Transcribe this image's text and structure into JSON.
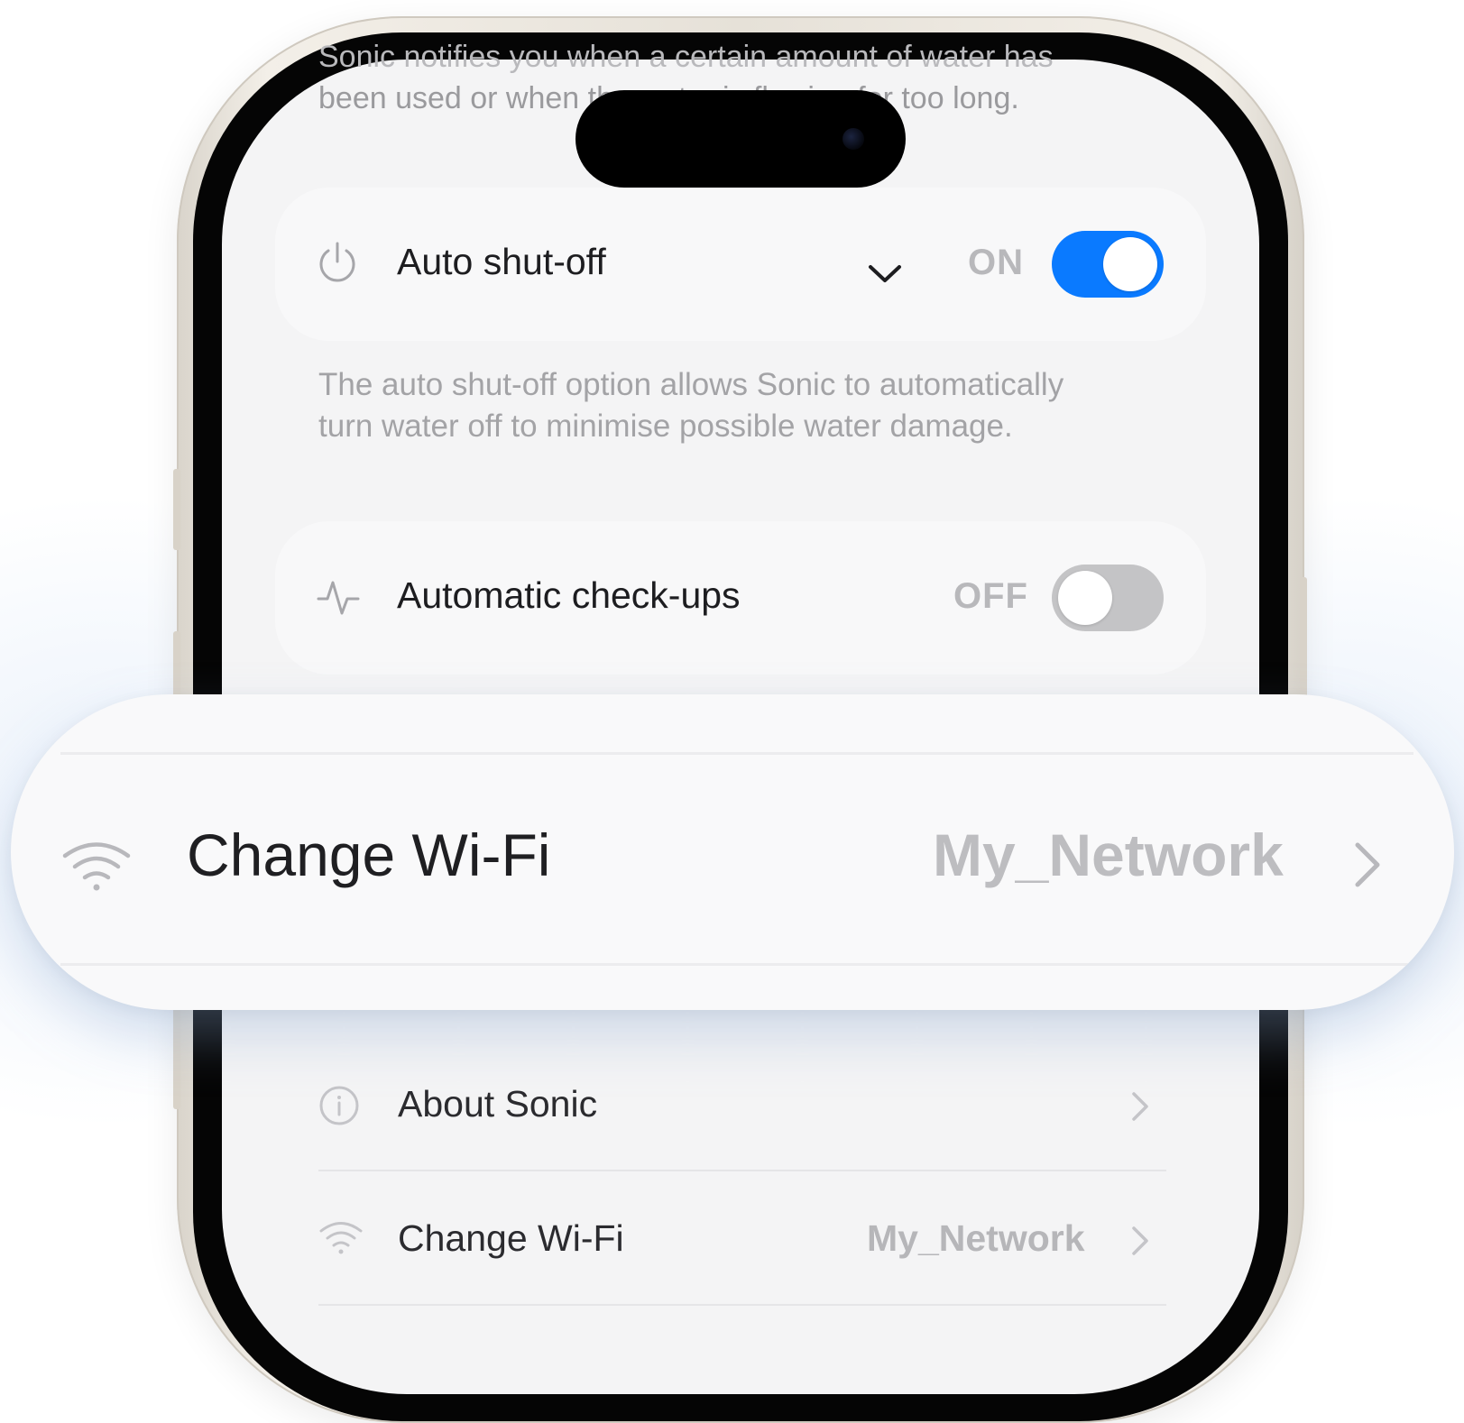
{
  "screen": {
    "top_text_line1": "Sonic notifies you when a certain amount of water has",
    "top_text_line2": "been used or when the water is flowing for too long."
  },
  "auto_shutoff": {
    "label": "Auto shut-off",
    "state_label": "ON",
    "enabled": true,
    "description_line1": "The auto shut-off option allows Sonic to automatically",
    "description_line2": "turn water off to minimise possible water damage."
  },
  "auto_checkups": {
    "label": "Automatic check-ups",
    "state_label": "OFF",
    "enabled": false
  },
  "list": {
    "about": {
      "label": "About Sonic"
    },
    "wifi": {
      "label": "Change Wi-Fi",
      "value": "My_Network"
    }
  },
  "overlay": {
    "label": "Change Wi-Fi",
    "value": "My_Network"
  },
  "colors": {
    "accent": "#0a7aff",
    "toggle_off": "#c4c4c6"
  },
  "icons": [
    "power-icon",
    "chevron-down-icon",
    "pulse-icon",
    "info-icon",
    "wifi-icon",
    "chevron-right-icon"
  ]
}
